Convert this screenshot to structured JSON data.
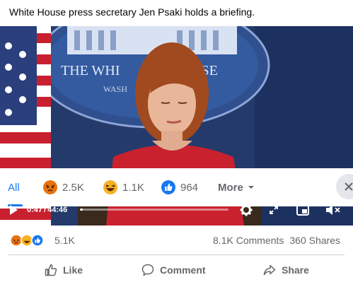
{
  "post": {
    "caption": "White House press secretary Jen Psaki holds a briefing."
  },
  "video_scene": {
    "sign_text_line1": "THE WHI",
    "sign_text_line1b": "USE",
    "sign_text_line2": "WASH"
  },
  "reaction_tabs": {
    "all_label": "All",
    "angry_count": "2.5K",
    "haha_count": "1.1K",
    "like_count": "964",
    "more_label": "More"
  },
  "player": {
    "current_time": "0:47",
    "separator": "/",
    "duration": "44:46",
    "progress_fraction": 0.018
  },
  "stats": {
    "reaction_total": "5.1K",
    "comments": "8.1K Comments",
    "shares": "360 Shares"
  },
  "actions": {
    "like_label": "Like",
    "comment_label": "Comment",
    "share_label": "Share"
  },
  "colors": {
    "accent": "#1877f2",
    "muted": "#65676b",
    "angry": "#e9710f",
    "haha": "#f7b125"
  }
}
